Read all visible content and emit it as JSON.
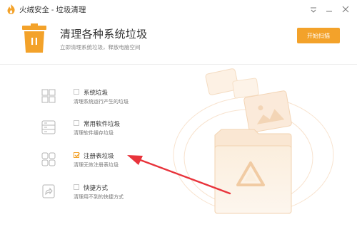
{
  "window": {
    "title": "火绒安全 - 垃圾清理"
  },
  "header": {
    "title": "清理各种系统垃圾",
    "subtitle": "立即清理系统垃圾，释放电脑空间",
    "start_button": "开始扫描"
  },
  "categories": [
    {
      "label": "系统垃圾",
      "desc": "清理系统运行产生的垃圾",
      "checked": false,
      "icon": "windows-icon"
    },
    {
      "label": "常用软件垃圾",
      "desc": "清理软件缓存垃圾",
      "checked": false,
      "icon": "software-icon"
    },
    {
      "label": "注册表垃圾",
      "desc": "清理无效注册表垃圾",
      "checked": true,
      "icon": "registry-icon"
    },
    {
      "label": "快捷方式",
      "desc": "清理用不到的快捷方式",
      "checked": false,
      "icon": "shortcut-icon"
    }
  ],
  "colors": {
    "accent": "#f3a22a",
    "annotation_arrow": "#e8333b"
  }
}
